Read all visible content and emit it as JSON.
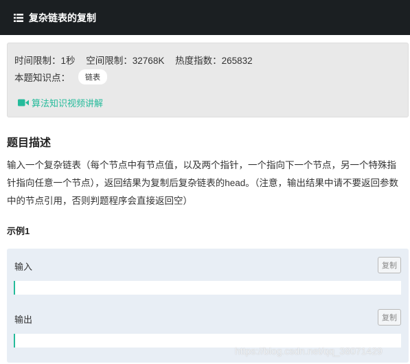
{
  "header": {
    "title": "复杂链表的复制",
    "icon": "list-icon"
  },
  "info": {
    "time_limit": "时间限制：1秒",
    "space_limit": "空间限制：32768K",
    "heat": "热度指数：265832",
    "knowledge_label": "本题知识点：",
    "tag": "链表",
    "video_link": "算法知识视频讲解"
  },
  "problem": {
    "section_title": "题目描述",
    "description": "输入一个复杂链表（每个节点中有节点值，以及两个指针，一个指向下一个节点，另一个特殊指针指向任意一个节点），返回结果为复制后复杂链表的head。（注意，输出结果中请不要返回参数中的节点引用，否则判题程序会直接返回空）"
  },
  "example": {
    "title": "示例1",
    "input_label": "输入",
    "output_label": "输出",
    "copy_label": "复制"
  },
  "watermark": "https://blog.csdn.net/qq_38071429",
  "colors": {
    "accent": "#25bb9b",
    "header_bg": "#1b1f22"
  }
}
